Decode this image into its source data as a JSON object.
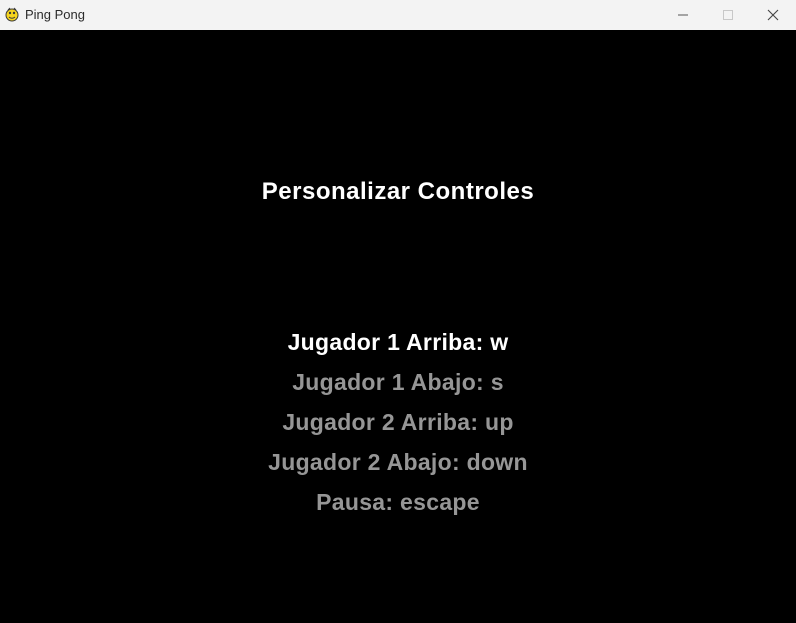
{
  "window": {
    "title": "Ping Pong",
    "app_icon": "pygame-snake-icon",
    "buttons": [
      "minimize-icon",
      "maximize-icon",
      "close-icon"
    ]
  },
  "colors": {
    "background": "#000000",
    "titlebar": "#f3f3f3",
    "text_selected": "#ffffff",
    "text_unselected": "#969696"
  },
  "screen": {
    "title": "Personalizar Controles",
    "selected_index": 0,
    "controls": [
      {
        "label": "Jugador 1 Arriba: w"
      },
      {
        "label": "Jugador 1 Abajo: s"
      },
      {
        "label": "Jugador 2 Arriba: up"
      },
      {
        "label": "Jugador 2 Abajo: down"
      },
      {
        "label": "Pausa: escape"
      }
    ]
  }
}
